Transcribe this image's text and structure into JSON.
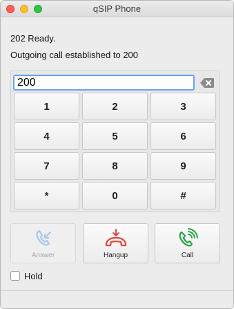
{
  "window": {
    "title": "qSIP Phone"
  },
  "status": {
    "line1": "202 Ready.",
    "line2": "Outgoing call established to 200"
  },
  "dialer": {
    "number": "200",
    "keys": [
      "1",
      "2",
      "3",
      "4",
      "5",
      "6",
      "7",
      "8",
      "9",
      "*",
      "0",
      "#"
    ]
  },
  "actions": {
    "answer": "Answer",
    "hangup": "Hangup",
    "call": "Call"
  },
  "hold": {
    "label": "Hold",
    "checked": false
  },
  "colors": {
    "answer_icon": "#a9c8e8",
    "hangup_icon": "#e0473c",
    "call_icon": "#27a345"
  }
}
